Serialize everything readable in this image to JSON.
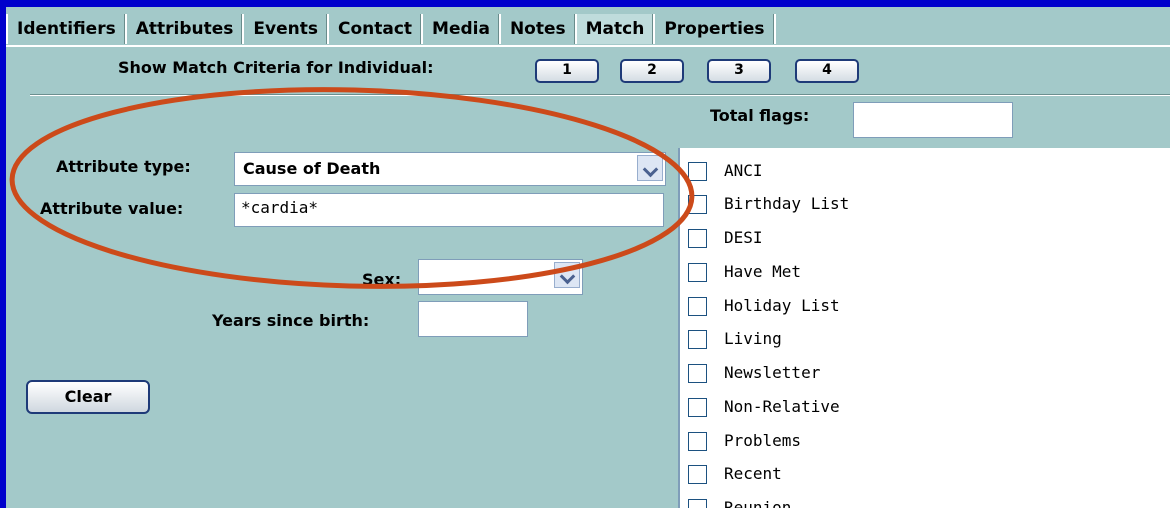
{
  "tabs": [
    "Identifiers",
    "Attributes",
    "Events",
    "Contact",
    "Media",
    "Notes",
    "Match",
    "Properties"
  ],
  "active_tab": "Match",
  "match_criteria": {
    "label": "Show Match Criteria for Individual:",
    "buttons": [
      "1",
      "2",
      "3",
      "4"
    ]
  },
  "total_flags": {
    "label": "Total flags:",
    "value": ""
  },
  "attribute_type": {
    "label": "Attribute type:",
    "value": "Cause of Death"
  },
  "attribute_value": {
    "label": "Attribute value:",
    "value": "*cardia*"
  },
  "sex": {
    "label": "Sex:",
    "value": ""
  },
  "years_since_birth": {
    "label": "Years since birth:",
    "value": ""
  },
  "clear_label": "Clear",
  "flags": [
    "ANCI",
    "Birthday List",
    "DESI",
    "Have Met",
    "Holiday List",
    "Living",
    "Newsletter",
    "Non-Relative",
    "Problems",
    "Recent",
    "Reunion"
  ],
  "colors": {
    "panel": "#a3c9c9",
    "frame": "#0000cc",
    "highlight_oval": "#cc4a1a"
  }
}
